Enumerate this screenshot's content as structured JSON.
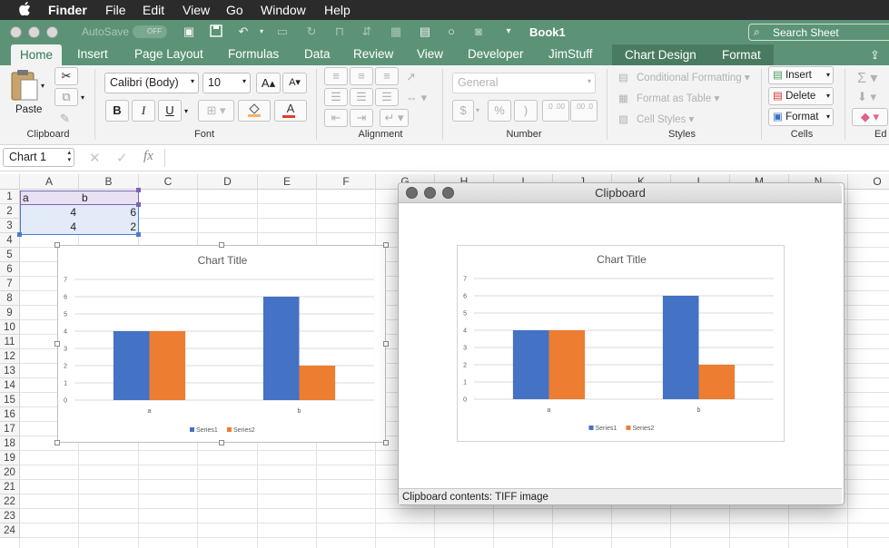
{
  "menubar": {
    "apple": "",
    "app": "Finder",
    "items": [
      "File",
      "Edit",
      "View",
      "Go",
      "Window",
      "Help"
    ]
  },
  "titlebar": {
    "autosave_label": "AutoSave",
    "autosave_state": "OFF",
    "doc_title": "Book1",
    "search_placeholder": "Search Sheet"
  },
  "tabs": [
    "Home",
    "Insert",
    "Page Layout",
    "Formulas",
    "Data",
    "Review",
    "View",
    "Developer",
    "JimStuff"
  ],
  "context_tabs": [
    "Chart Design",
    "Format"
  ],
  "ribbon": {
    "paste_label": "Paste",
    "clipboard_group": "Clipboard",
    "font_name": "Calibri (Body)",
    "font_size": "10",
    "font_group": "Font",
    "bold": "B",
    "italic": "I",
    "underline": "U",
    "grow_font": "A",
    "shrink_font": "A",
    "alignment_group": "Alignment",
    "number_format": "General",
    "number_group": "Number",
    "currency": "$",
    "percent": "%",
    "comma": ")",
    "inc_decimal": ".0 .00",
    "dec_decimal": ".00 .0",
    "conditional_formatting": "Conditional Formatting",
    "format_as_table": "Format as Table",
    "cell_styles": "Cell Styles",
    "styles_group": "Styles",
    "insert": "Insert",
    "delete": "Delete",
    "format": "Format",
    "cells_group": "Cells",
    "editing_group": "Ed"
  },
  "formula_bar": {
    "name_box": "Chart 1",
    "fx": "fx",
    "cancel": "✕",
    "confirm": "✓",
    "formula": ""
  },
  "columns": [
    "A",
    "B",
    "C",
    "D",
    "E",
    "F",
    "G",
    "H",
    "I",
    "J",
    "K",
    "L",
    "M",
    "N",
    "O"
  ],
  "rows": [
    "1",
    "2",
    "3",
    "4",
    "5",
    "6",
    "7",
    "8",
    "9",
    "10",
    "11",
    "12",
    "13",
    "14",
    "15",
    "16",
    "17",
    "18",
    "19",
    "20",
    "21",
    "22",
    "23",
    "24"
  ],
  "cells": {
    "A1": "a",
    "B1": "b",
    "A2": "4",
    "B2": "6",
    "A3": "4",
    "B3": "2"
  },
  "clipboard_window": {
    "title": "Clipboard",
    "status": "Clipboard contents: TIFF image"
  },
  "colors": {
    "ribbon_green": "#5c9377",
    "series1": "#4472c4",
    "series2": "#ed7d31",
    "selection_purple": "#7f62b7",
    "selection_blue": "#4c7cd0"
  },
  "chart_data": [
    {
      "type": "bar",
      "title": "Chart Title",
      "categories": [
        "a",
        "b"
      ],
      "series": [
        {
          "name": "Series1",
          "values": [
            4,
            6
          ]
        },
        {
          "name": "Series2",
          "values": [
            4,
            2
          ]
        }
      ],
      "ylim": [
        0,
        7
      ],
      "yticks": [
        "0",
        "1",
        "2",
        "3",
        "4",
        "5",
        "6",
        "7"
      ],
      "grid": true,
      "legend": "bottom"
    },
    {
      "type": "bar",
      "title": "Chart Title",
      "categories": [
        "a",
        "b"
      ],
      "series": [
        {
          "name": "Series1",
          "values": [
            4,
            6
          ]
        },
        {
          "name": "Series2",
          "values": [
            4,
            2
          ]
        }
      ],
      "ylim": [
        0,
        7
      ],
      "yticks": [
        "0",
        "1",
        "2",
        "3",
        "4",
        "5",
        "6",
        "7"
      ],
      "grid": true,
      "legend": "bottom"
    }
  ]
}
